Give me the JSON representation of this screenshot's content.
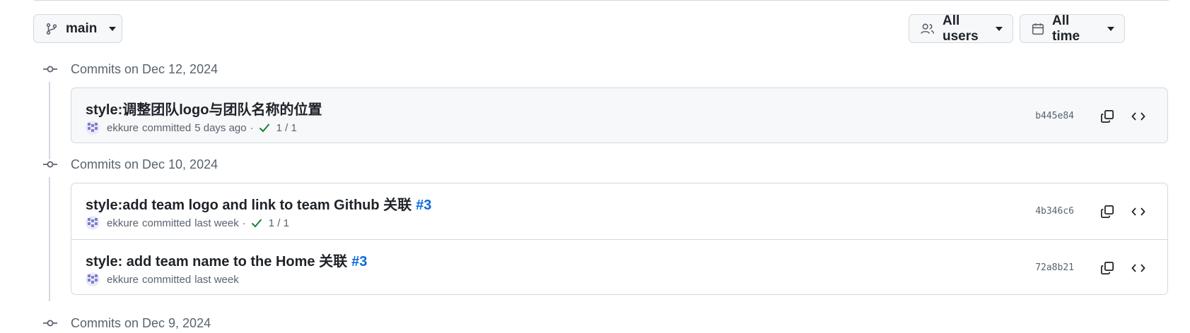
{
  "branch_selector": {
    "label": "main"
  },
  "filters": {
    "users_label": "All users",
    "time_label": "All time"
  },
  "groups": [
    {
      "date_label": "Commits on Dec 12, 2024",
      "commits": [
        {
          "title": "style:调整团队logo与团队名称的位置",
          "issue_ref": "",
          "author": "ekkure",
          "action": "committed",
          "time": "5 days ago",
          "separator": "·",
          "checks": "1 / 1",
          "sha": "b445e84"
        }
      ]
    },
    {
      "date_label": "Commits on Dec 10, 2024",
      "commits": [
        {
          "title": "style:add team logo and link to team Github 关联",
          "issue_ref": "#3",
          "author": "ekkure",
          "action": "committed",
          "time": "last week",
          "separator": "·",
          "checks": "1 / 1",
          "sha": "4b346c6"
        },
        {
          "title": "style: add team name to the Home 关联",
          "issue_ref": "#3",
          "author": "ekkure",
          "action": "committed",
          "time": "last week",
          "sha": "72a8b21"
        }
      ]
    },
    {
      "date_label": "Commits on Dec 9, 2024"
    }
  ],
  "colors": {
    "link": "#0969da",
    "success": "#1a7f37",
    "muted": "#59636e",
    "border": "#d1d9e0",
    "canvas_subtle": "#f6f8fa"
  },
  "icons": [
    "git-branch-icon",
    "people-icon",
    "calendar-icon",
    "git-commit-icon",
    "check-icon",
    "copy-icon",
    "code-icon"
  ]
}
